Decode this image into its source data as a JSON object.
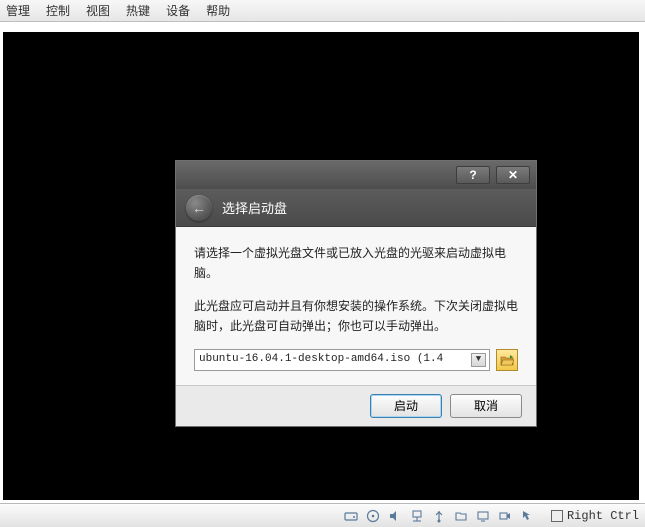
{
  "menubar": {
    "items": [
      "管理",
      "控制",
      "视图",
      "热键",
      "设备",
      "帮助"
    ]
  },
  "dialog": {
    "help_symbol": "?",
    "close_symbol": "✕",
    "back_symbol": "←",
    "title": "选择启动盘",
    "para1": "请选择一个虚拟光盘文件或已放入光盘的光驱来启动虚拟电脑。",
    "para2": "此光盘应可启动并且有你想安装的操作系统。下次关闭虚拟电脑时，此光盘可自动弹出；你也可以手动弹出。",
    "combo_value": "ubuntu-16.04.1-desktop-amd64.iso (1.4",
    "caret": "▼",
    "start_label": "启动",
    "cancel_label": "取消"
  },
  "statusbar": {
    "host_key": "Right Ctrl"
  }
}
